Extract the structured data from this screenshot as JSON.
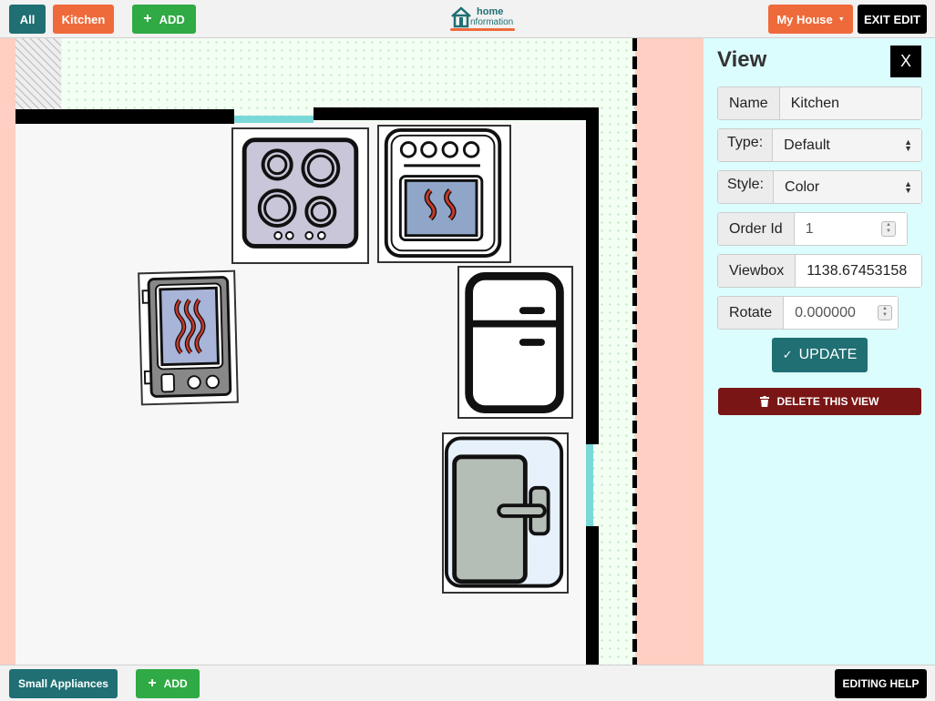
{
  "topbar": {
    "all_label": "All",
    "kitchen_label": "Kitchen",
    "add_label": "ADD",
    "logo_line1": "home",
    "logo_line2": "nformation",
    "house_label": "My House",
    "exit_label": "EXIT EDIT"
  },
  "panel": {
    "title": "View",
    "close_label": "X",
    "name_label": "Name",
    "name_value": "Kitchen",
    "type_label": "Type:",
    "type_value": "Default",
    "style_label": "Style:",
    "style_value": "Color",
    "order_label": "Order Id",
    "order_value": "1",
    "viewbox_label": "Viewbox",
    "viewbox_value": "1138.67453158",
    "rotate_label": "Rotate",
    "rotate_value": "0.000000",
    "update_label": "UPDATE",
    "delete_label": "DELETE THIS VIEW"
  },
  "bottombar": {
    "category_label": "Small Appliances",
    "add_label": "ADD",
    "help_label": "EDITING HELP"
  },
  "colors": {
    "teal": "#1f6f73",
    "orange": "#ef6a3a",
    "green": "#2faa44",
    "dark_red": "#7a1515",
    "panel_bg": "#dcfdfd",
    "exterior": "#ffcfc3"
  },
  "icons": [
    "home-logo-icon",
    "plus-icon",
    "caret-down-icon",
    "check-icon",
    "trash-icon",
    "cooktop-icon",
    "oven-icon",
    "toaster-oven-icon",
    "refrigerator-icon",
    "dishwasher-icon"
  ]
}
